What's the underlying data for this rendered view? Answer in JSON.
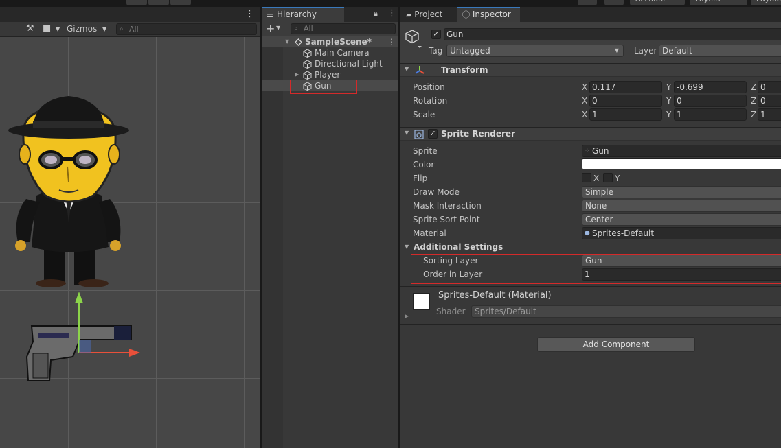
{
  "toolbar": {
    "account_label": "Account",
    "layers_label": "Layers",
    "layout_label": "Layout"
  },
  "scene": {
    "gizmos_label": "Gizmos",
    "search_placeholder": "All"
  },
  "hierarchy": {
    "tab_label": "Hierarchy",
    "search_placeholder": "All",
    "scene_name": "SampleScene*",
    "items": [
      {
        "label": "Main Camera"
      },
      {
        "label": "Directional Light"
      },
      {
        "label": "Player"
      },
      {
        "label": "Gun"
      }
    ]
  },
  "inspector": {
    "tabs": [
      {
        "label": "Project"
      },
      {
        "label": "Inspector"
      }
    ],
    "object_name": "Gun",
    "tag_label": "Tag",
    "tag_value": "Untagged",
    "layer_label": "Layer",
    "layer_value": "Default",
    "transform": {
      "title": "Transform",
      "rows": [
        {
          "label": "Position",
          "x": "0.117",
          "y": "-0.699",
          "z": "0"
        },
        {
          "label": "Rotation",
          "x": "0",
          "y": "0",
          "z": "0"
        },
        {
          "label": "Scale",
          "x": "1",
          "y": "1",
          "z": "1"
        }
      ]
    },
    "axis_labels": {
      "x": "X",
      "y": "Y",
      "z": "Z"
    },
    "sprite_renderer": {
      "title": "Sprite Renderer",
      "sprite_label": "Sprite",
      "sprite_value": "Gun",
      "color_label": "Color",
      "color_value": "#ffffff",
      "flip_label": "Flip",
      "flip_x": "X",
      "flip_y": "Y",
      "draw_mode_label": "Draw Mode",
      "draw_mode_value": "Simple",
      "mask_label": "Mask Interaction",
      "mask_value": "None",
      "sort_point_label": "Sprite Sort Point",
      "sort_point_value": "Center",
      "material_label": "Material",
      "material_value": "Sprites-Default",
      "additional_settings_label": "Additional Settings",
      "sorting_layer_label": "Sorting Layer",
      "sorting_layer_value": "Gun",
      "order_label": "Order in Layer",
      "order_value": "1"
    },
    "material": {
      "title": "Sprites-Default (Material)",
      "shader_label": "Shader",
      "shader_value": "Sprites/Default"
    },
    "add_component_label": "Add Component"
  },
  "colors": {
    "accent": "#3a79bb",
    "highlight_box": "#d42a2a",
    "panel_bg": "#383838",
    "scene_bg": "#474747"
  }
}
